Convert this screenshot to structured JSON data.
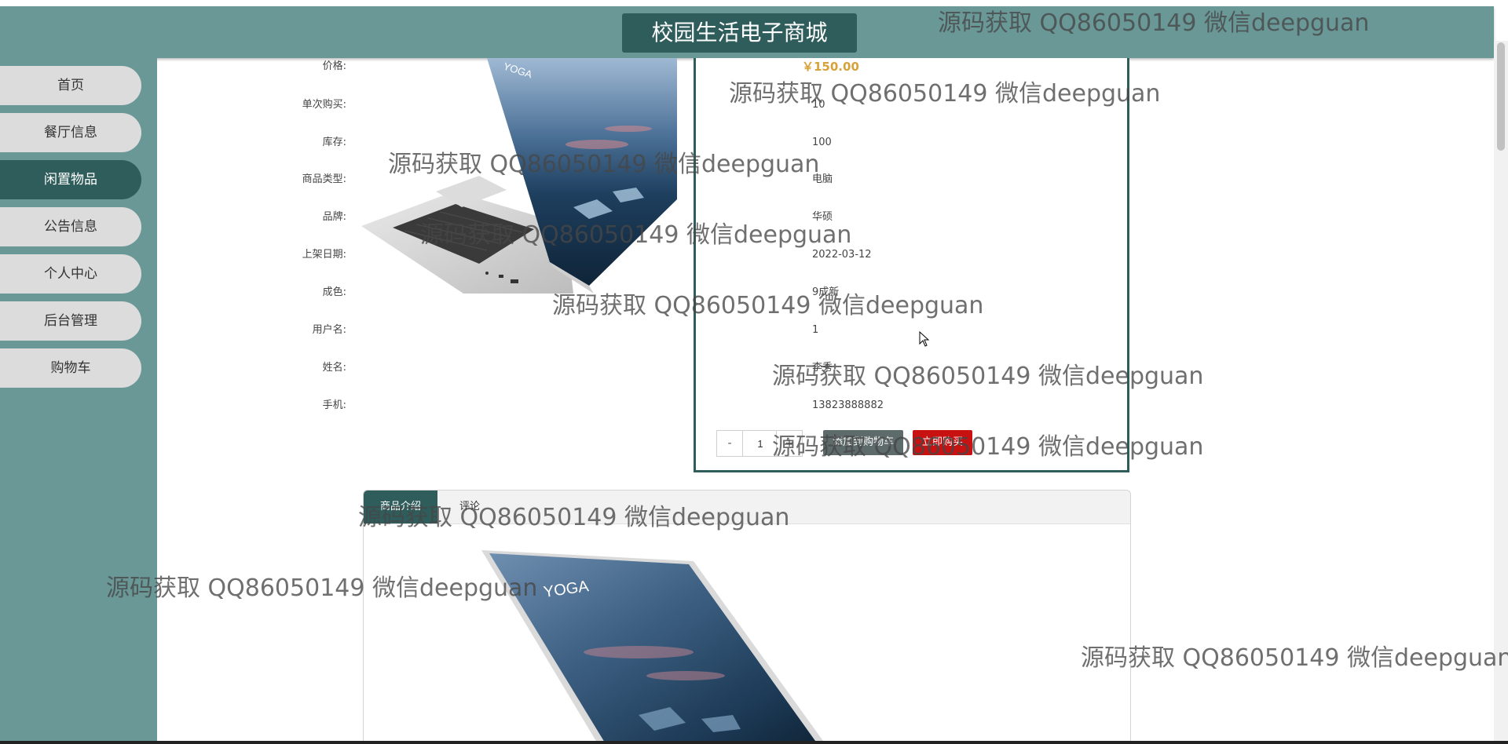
{
  "header": {
    "site_title": "校园生活电子商城"
  },
  "sidebar": {
    "items": [
      {
        "label": "首页"
      },
      {
        "label": "餐厅信息"
      },
      {
        "label": "闲置物品",
        "active": true
      },
      {
        "label": "公告信息"
      },
      {
        "label": "个人中心"
      },
      {
        "label": "后台管理"
      },
      {
        "label": "购物车"
      }
    ]
  },
  "product": {
    "image_brand_text": "YOGA",
    "fields": [
      {
        "label": "价格:",
        "value": "￥150.00"
      },
      {
        "label": "单次购买:",
        "value": "10"
      },
      {
        "label": "库存:",
        "value": "100"
      },
      {
        "label": "商品类型:",
        "value": "电脑"
      },
      {
        "label": "品牌:",
        "value": "华硕"
      },
      {
        "label": "上架日期:",
        "value": "2022-03-12"
      },
      {
        "label": "成色:",
        "value": "9成新"
      },
      {
        "label": "用户名:",
        "value": "1"
      },
      {
        "label": "姓名:",
        "value": "李秀"
      },
      {
        "label": "手机:",
        "value": "13823888882"
      }
    ],
    "quantity": {
      "minus": "-",
      "value": "1",
      "plus": "+"
    },
    "add_to_cart_label": "添加到购物车",
    "buy_now_label": "立即购买"
  },
  "tabs": [
    {
      "label": "商品介绍",
      "active": true
    },
    {
      "label": "评论"
    }
  ],
  "watermark": "源码获取 QQ86050149 微信deepguan",
  "colors": {
    "header_bg": "#6a9897",
    "title_bg": "#2f5d5b",
    "active_nav": "#2f5d5b",
    "price": "#d8a23a",
    "buy_button": "#c81111",
    "cart_button": "#5d6b6a"
  }
}
